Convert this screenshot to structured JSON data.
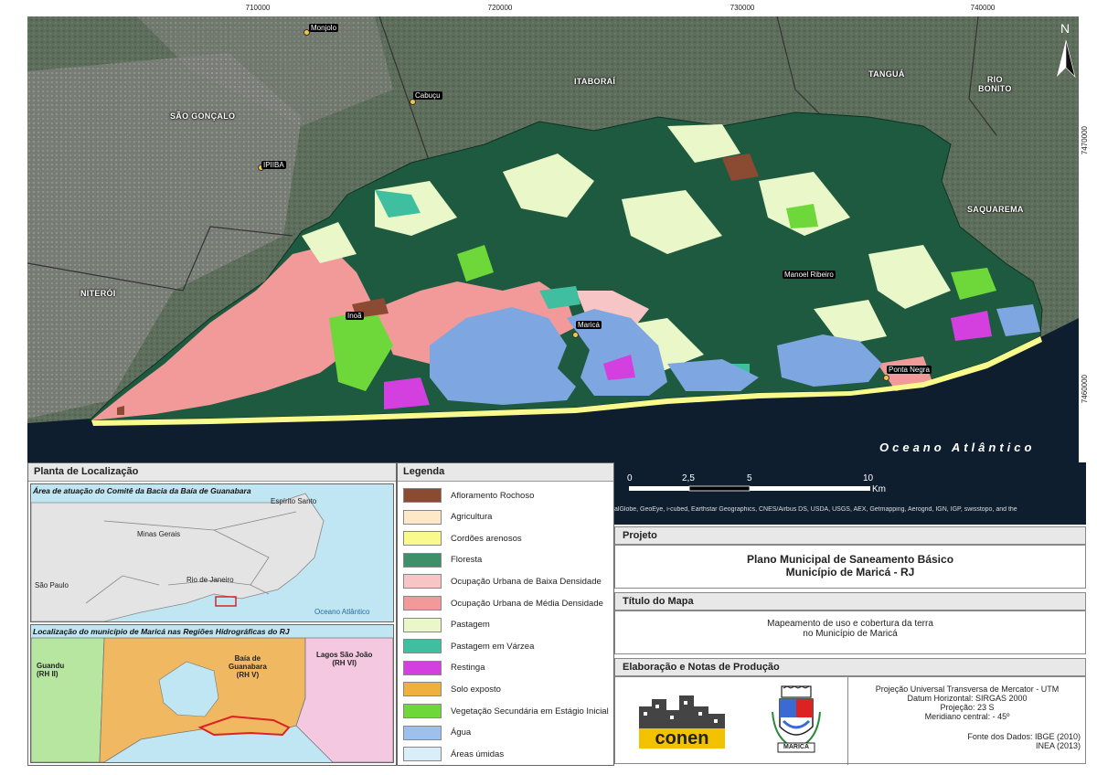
{
  "coords": {
    "x": [
      "710000",
      "720000",
      "730000",
      "740000"
    ],
    "y": [
      "7470000",
      "7460000"
    ]
  },
  "places": {
    "monjolo": "Monjolo",
    "sao_goncalo": "SÃO GONÇALO",
    "cabucu": "Cabuçu",
    "itaborai": "ITABORAÍ",
    "tangua": "TANGUÁ",
    "rio_bonito": "RIO\nBONITO",
    "ipiiba": "IPIIBA",
    "saquarema": "SAQUAREMA",
    "niteroi": "NITERÓI",
    "manoel_ribeiro": "Manoel Ribeiro",
    "inoa": "Inoã",
    "marica": "Maricá",
    "ponta_negra": "Ponta Negra",
    "ocean": "Oceano Atlântico"
  },
  "scale": {
    "ticks": [
      "0",
      "2,5",
      "5",
      "10"
    ],
    "unit": "Km",
    "attribution": "alGlobe, GeoEye, i-cubed, Earthstar Geographics, CNES/Airbus DS, USDA, USGS, AEX, Getmapping, Aerogrid, IGN, IGP, swisstopo, and the"
  },
  "location_panel": {
    "title": "Planta de Localização",
    "map1_title": "Área de atuação do Comitê da Bacia da Baía de Guanabara",
    "states": [
      "Espírito Santo",
      "Minas Gerais",
      "São Paulo",
      "Rio de Janeiro"
    ],
    "ocean": "Oceano Atlântico",
    "map2_title": "Localização do município de Maricá nas Regiões Hidrográficas do  RJ",
    "regions": {
      "guandu": "Guandu\n(RH II)",
      "guanabara": "Baía de\nGuanabara\n(RH V)",
      "lagos": "Lagos São João\n(RH VI)"
    }
  },
  "legend": {
    "title": "Legenda",
    "items": [
      {
        "label": "Afloramento Rochoso",
        "color": "#8b4a32"
      },
      {
        "label": "Agricultura",
        "color": "#fde8c8"
      },
      {
        "label": "Cordões arenosos",
        "color": "#fafa8c"
      },
      {
        "label": "Floresta",
        "color": "#3f8f6b"
      },
      {
        "label": "Ocupação Urbana de Baixa Densidade",
        "color": "#f7c5c5"
      },
      {
        "label": "Ocupação Urbana de Média Densidade",
        "color": "#f29a9a"
      },
      {
        "label": "Pastagem",
        "color": "#eaf7c8"
      },
      {
        "label": "Pastagem em Várzea",
        "color": "#3fbf9f"
      },
      {
        "label": "Restinga",
        "color": "#d43fe0"
      },
      {
        "label": "Solo exposto",
        "color": "#f0b040"
      },
      {
        "label": "Vegetação Secundária em Estágio Inicial",
        "color": "#6ed83a"
      },
      {
        "label": "Água",
        "color": "#9ec0ee"
      },
      {
        "label": "Áreas úmidas",
        "color": "#d8eef8"
      }
    ]
  },
  "project": {
    "head": "Projeto",
    "line1": "Plano Municipal de Saneamento Básico",
    "line2": "Município de Maricá - RJ"
  },
  "map_title": {
    "head": "Título do Mapa",
    "line1": "Mapeamento de uso e cobertura da terra",
    "line2": "no Município de Maricá"
  },
  "production": {
    "head": "Elaboração e Notas de Produção",
    "logo_text": "conen",
    "seal_text": "MARICÁ",
    "projection": "Projeção Universal Transversa de Mercator - UTM",
    "datum": "Datum Horizontal: SIRGAS 2000",
    "zone": "Projeção: 23 S",
    "meridian": "Meridiano central: - 45º",
    "sources1": "Fonte dos Dados: IBGE (2010)",
    "sources2": "INEA (2013)"
  },
  "colors": {
    "forest_dark": "#1e5a40",
    "water": "#7ea6e0",
    "ocean": "#0e1e2e"
  }
}
